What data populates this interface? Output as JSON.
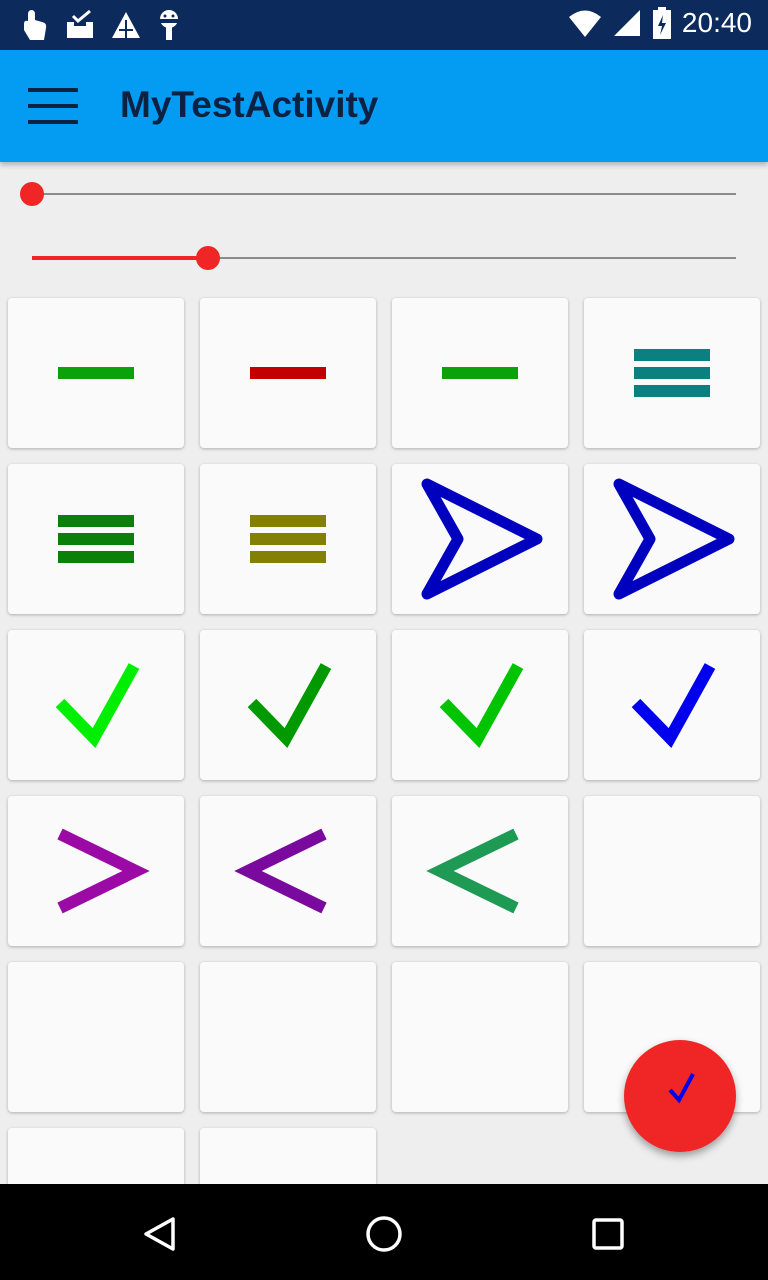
{
  "status_bar": {
    "time": "20:40",
    "left_icons": [
      "touch-icon",
      "inbox-check-icon",
      "triangle-icon",
      "android-icon"
    ],
    "right_icons": [
      "wifi-icon",
      "signal-icon",
      "battery-charging-icon"
    ]
  },
  "app_bar": {
    "title": "MyTestActivity",
    "menu_icon": "hamburger-menu-icon",
    "color": "#039cf2"
  },
  "sliders": [
    {
      "name": "slider-1",
      "value": 0.0
    },
    {
      "name": "slider-2",
      "value": 0.25
    }
  ],
  "accent_color": "#f02525",
  "grid_cards": [
    {
      "icon": "minus-icon",
      "color": "#0aa10a"
    },
    {
      "icon": "minus-icon",
      "color": "#c20000"
    },
    {
      "icon": "minus-icon",
      "color": "#0aa10a"
    },
    {
      "icon": "menu-lines-icon",
      "color": "#0a8080"
    },
    {
      "icon": "menu-lines-icon",
      "color": "#0a7f0a"
    },
    {
      "icon": "menu-lines-icon",
      "color": "#848006"
    },
    {
      "icon": "send-arrow-icon",
      "color": "#0000bf"
    },
    {
      "icon": "send-arrow-icon",
      "color": "#0000bf"
    },
    {
      "icon": "check-icon",
      "color": "#00ee00"
    },
    {
      "icon": "check-icon",
      "color": "#009a00"
    },
    {
      "icon": "check-icon",
      "color": "#00c400"
    },
    {
      "icon": "check-icon",
      "color": "#0000ee"
    },
    {
      "icon": "chevron-right-icon",
      "color": "#9c0aa6"
    },
    {
      "icon": "chevron-left-icon",
      "color": "#7a0a9e"
    },
    {
      "icon": "chevron-left-icon",
      "color": "#1f9a55"
    },
    {
      "icon": "empty",
      "color": ""
    },
    {
      "icon": "empty",
      "color": ""
    },
    {
      "icon": "empty",
      "color": ""
    },
    {
      "icon": "empty",
      "color": ""
    },
    {
      "icon": "empty",
      "color": ""
    },
    {
      "icon": "empty",
      "color": ""
    },
    {
      "icon": "empty",
      "color": ""
    }
  ],
  "fab": {
    "icon": "check-icon",
    "icon_color": "#0000ee",
    "color": "#f02525"
  },
  "nav_bar": {
    "buttons": [
      "back-icon",
      "home-icon",
      "recents-icon"
    ]
  }
}
